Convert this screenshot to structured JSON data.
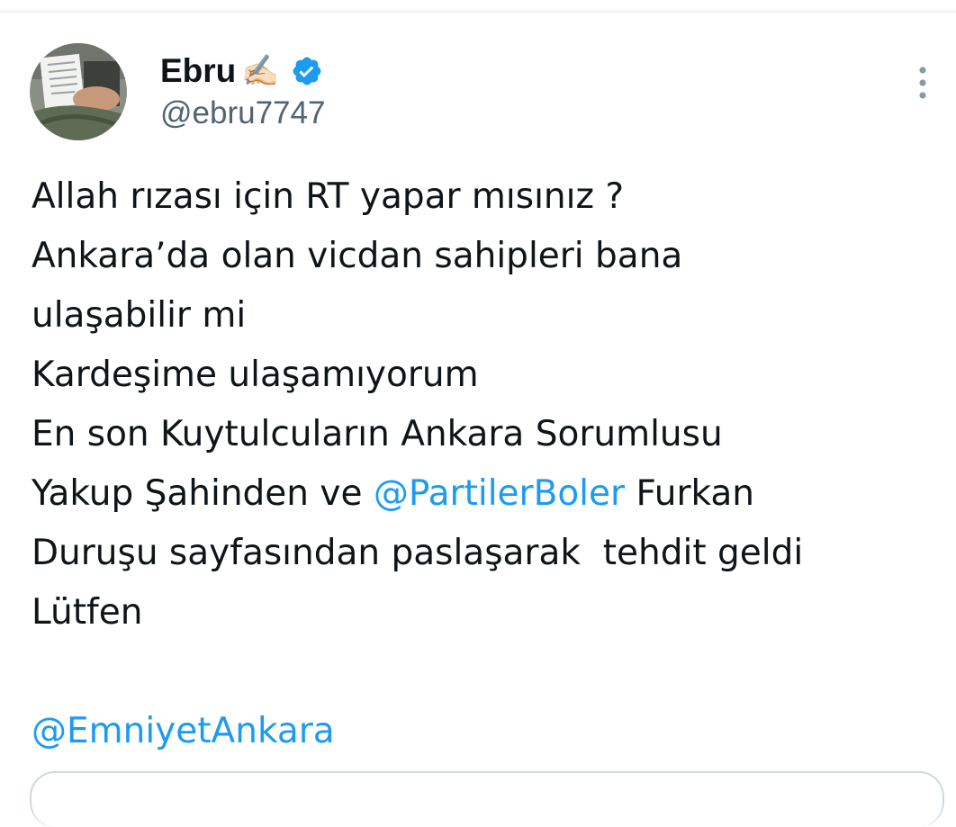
{
  "author": {
    "display_name": "Ebru",
    "name_emoji": "✍🏻",
    "handle": "@ebru7747",
    "verified": true
  },
  "icons": {
    "avatar": "avatar-photo",
    "verified": "verified-badge-icon",
    "more": "more-vertical-icon"
  },
  "colors": {
    "text": "#0f1419",
    "secondary": "#536471",
    "link": "#1d9bf0",
    "border": "#cfd9de"
  },
  "tweet": {
    "lines": [
      {
        "text": "Allah rızası için RT yapar mısınız ?"
      },
      {
        "text": "Ankara’da olan vicdan sahipleri bana"
      },
      {
        "text": "ulaşabilir mi"
      },
      {
        "text": "Kardeşime ulaşamıyorum"
      },
      {
        "text": "En son Kuytulcuların Ankara Sorumlusu"
      },
      {
        "before": "Yakup Şahinden ve ",
        "mention": "@PartilerBoler",
        "after": " Furkan"
      },
      {
        "text": "Duruşu sayfasından paslaşarak  tehdit geldi"
      },
      {
        "text": "Lütfen"
      },
      {
        "text": ""
      },
      {
        "mention": "@EmniyetAnkara"
      }
    ]
  }
}
